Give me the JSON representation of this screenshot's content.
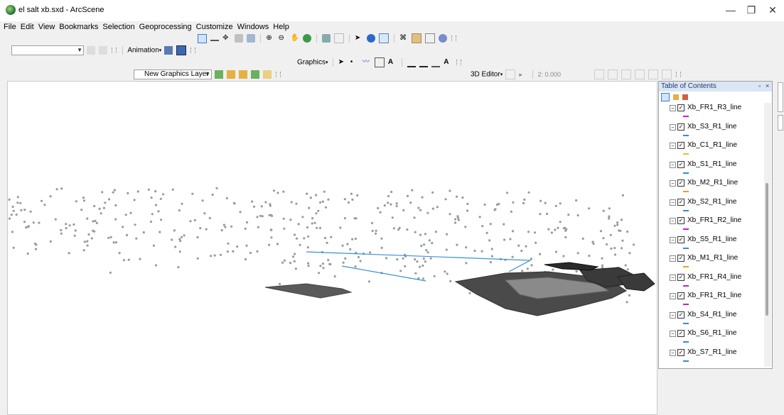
{
  "window": {
    "title": "el salt xb.sxd - ArcScene",
    "controls": {
      "minimize": "—",
      "maximize": "❐",
      "close": "✕"
    }
  },
  "menu": [
    "File",
    "Edit",
    "View",
    "Bookmarks",
    "Selection",
    "Geoprocessing",
    "Customize",
    "Windows",
    "Help"
  ],
  "toolbars": {
    "animation_label": "Animation",
    "graphics_label": "Graphics",
    "new_graphics_layer": "New Graphics Layer",
    "editor_label": "3D Editor",
    "editor_value": "2: 0.000"
  },
  "toc": {
    "title": "Table of Contents",
    "controls": {
      "dock": "▫",
      "close": "×"
    },
    "layers": [
      {
        "name": "Xb_FR1_R3_line",
        "color": "#c020d0"
      },
      {
        "name": "Xb_S3_R1_line",
        "color": "#2a90d8"
      },
      {
        "name": "Xb_C1_R1_line",
        "color": "#e8c020"
      },
      {
        "name": "Xb_S1_R1_line",
        "color": "#2a90d8"
      },
      {
        "name": "Xb_M2_R1_line",
        "color": "#e8a020"
      },
      {
        "name": "Xb_S2_R1_line",
        "color": "#2a90d8"
      },
      {
        "name": "Xb_FR1_R2_line",
        "color": "#c020d0"
      },
      {
        "name": "Xb_S5_R1_line",
        "color": "#2a90d8"
      },
      {
        "name": "Xb_M1_R1_line",
        "color": "#e8a020"
      },
      {
        "name": "Xb_FR1_R4_line",
        "color": "#c020d0"
      },
      {
        "name": "Xb_FR1_R1_line",
        "color": "#c020d0"
      },
      {
        "name": "Xb_S4_R1_line",
        "color": "#2a90d8"
      },
      {
        "name": "Xb_S6_R1_line",
        "color": "#2a90d8"
      },
      {
        "name": "Xb_S7_R1_line",
        "color": "#2a90d8"
      }
    ]
  },
  "colors": {
    "points": "#9a9a9a",
    "surface": "#555555",
    "line": "#3a8fd8"
  }
}
